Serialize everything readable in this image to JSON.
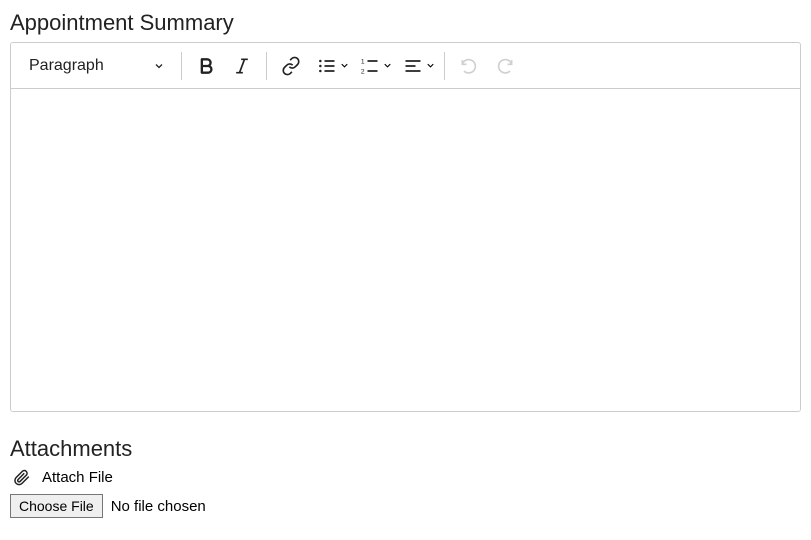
{
  "sections": {
    "summary_heading": "Appointment Summary",
    "attachments_heading": "Attachments"
  },
  "editor": {
    "block_type": "Paragraph",
    "content": ""
  },
  "icons": {
    "bold": "bold-icon",
    "italic": "italic-icon",
    "link": "link-icon",
    "bullet_list": "bullet-list-icon",
    "numbered_list": "numbered-list-icon",
    "align": "align-icon",
    "undo": "undo-icon",
    "redo": "redo-icon"
  },
  "attachments": {
    "attach_label": "Attach File",
    "choose_file_label": "Choose File",
    "no_file_text": "No file chosen"
  }
}
